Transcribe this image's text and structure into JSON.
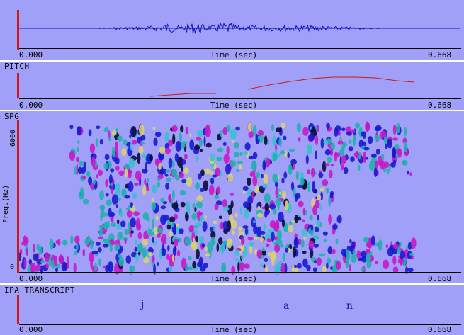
{
  "panels": {
    "waveform": {
      "title": ""
    },
    "pitch": {
      "title": "PITCH"
    },
    "spg": {
      "title": "SPG",
      "y_axis_label": "Freq.(Hz)",
      "y_max_label": "6000",
      "y_min_label": "0"
    },
    "ipa": {
      "title": "IPA TRANSCRIPT",
      "segments": [
        "j",
        "a",
        "n"
      ]
    }
  },
  "time_axis": {
    "start": "0.000",
    "label": "Time (sec)",
    "end": "0.668"
  },
  "colors": {
    "background": "#a0a0f8",
    "cursor": "#d01818",
    "waveform": "#1010c0",
    "pitch": "#d01818",
    "ipa": "#0a1a9a"
  }
}
